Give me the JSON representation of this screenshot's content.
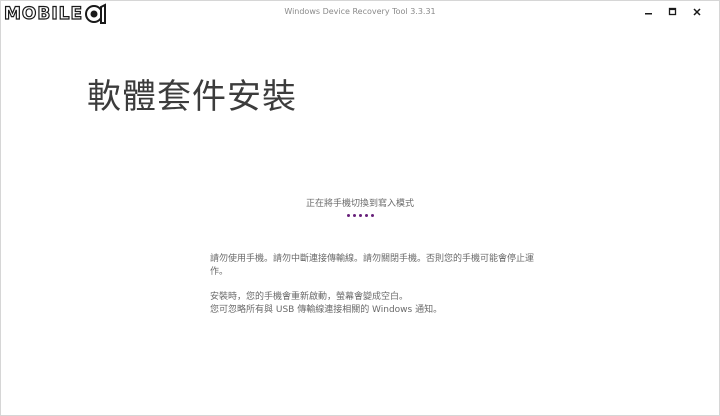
{
  "window": {
    "title": "Windows Device Recovery Tool 3.3.31",
    "logo_text": "MOBILE",
    "controls": {
      "minimize_icon": "minimize-icon",
      "maximize_icon": "maximize-icon",
      "close_icon": "close-icon"
    }
  },
  "main": {
    "title": "軟體套件安裝",
    "status_text": "正在將手機切換到寫入模式",
    "progress": {
      "dot_count": 5,
      "color": "#68217a"
    },
    "warnings": [
      "請勿使用手機。請勿中斷連接傳輸線。請勿關閉手機。否則您的手機可能會停止運作。",
      "安裝時，您的手機會重新啟動，螢幕會變成空白。",
      "您可忽略所有與 USB 傳輸線連接相關的 Windows 通知。"
    ]
  }
}
